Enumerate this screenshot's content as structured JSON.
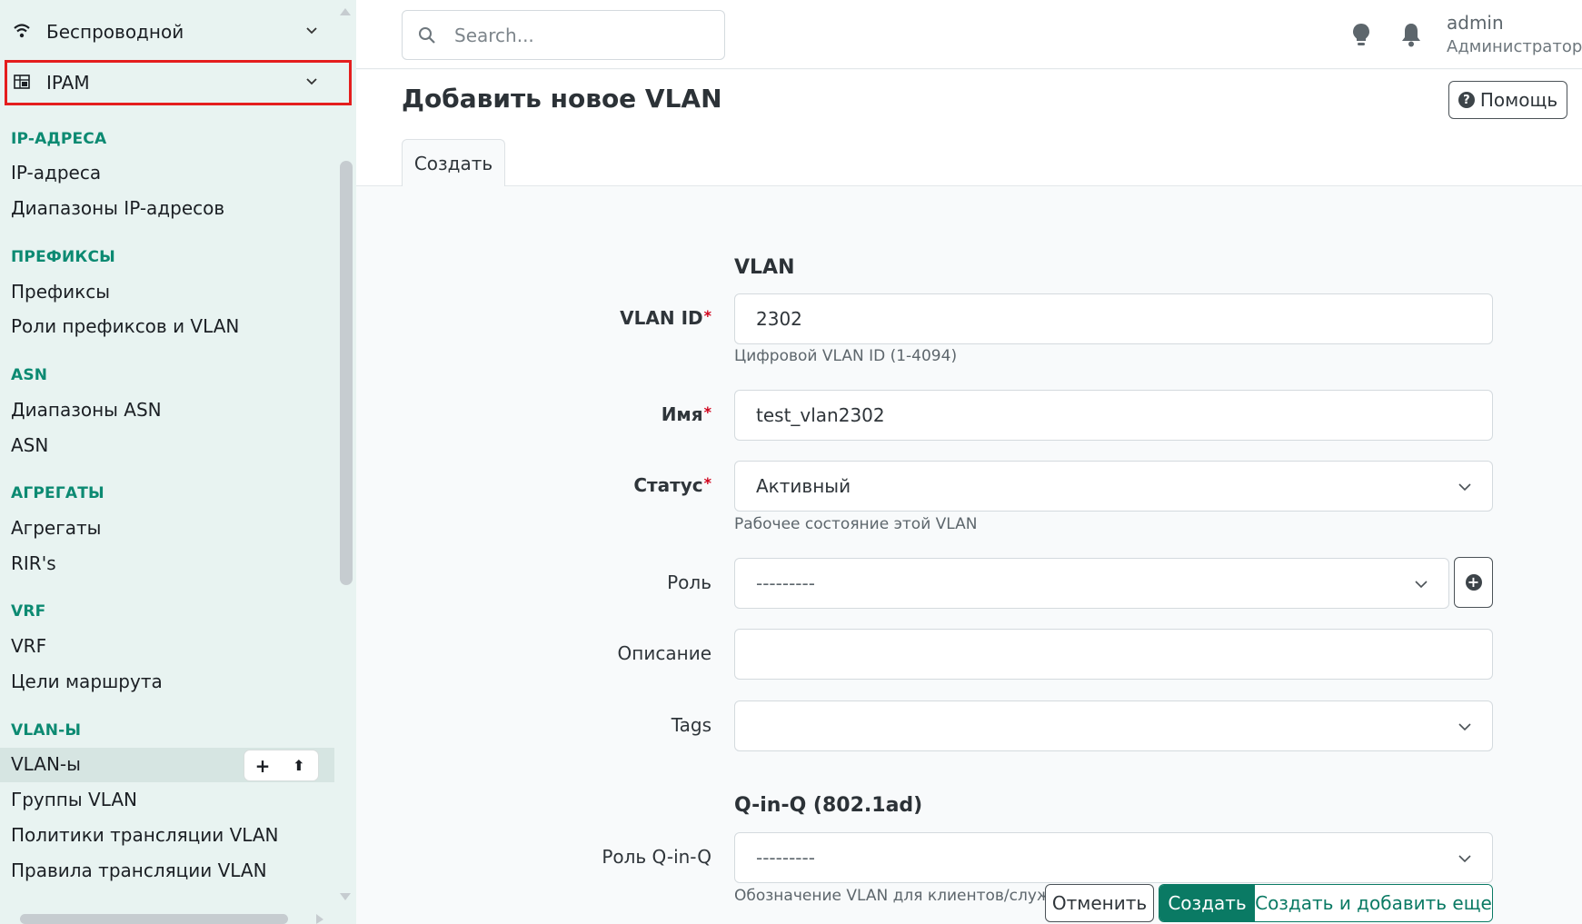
{
  "sidebar": {
    "top_items": [
      {
        "label": "Беспроводной",
        "icon": "wifi-icon"
      },
      {
        "label": "IPAM",
        "icon": "ipam-table-icon"
      }
    ],
    "sections": [
      {
        "header": "IP-АДРЕСА",
        "items": [
          "IP-адреса",
          "Диапазоны IP-адресов"
        ]
      },
      {
        "header": "ПРЕФИКСЫ",
        "items": [
          "Префиксы",
          "Роли префиксов и VLAN"
        ]
      },
      {
        "header": "ASN",
        "items": [
          "Диапазоны ASN",
          "ASN"
        ]
      },
      {
        "header": "АГРЕГАТЫ",
        "items": [
          "Агрегаты",
          "RIR's"
        ]
      },
      {
        "header": "VRF",
        "items": [
          "VRF",
          "Цели маршрута"
        ]
      },
      {
        "header": "VLAN-Ы",
        "items": [
          "VLAN-ы",
          "Группы VLAN",
          "Политики трансляции VLAN",
          "Правила трансляции VLAN"
        ]
      }
    ],
    "quick_actions": {
      "add": "+",
      "import": "⬆"
    }
  },
  "header": {
    "search_placeholder": "Search...",
    "user": {
      "name": "admin",
      "role": "Администратор"
    }
  },
  "page": {
    "title": "Добавить новое VLAN",
    "help_label": "Помощь",
    "tabs": [
      {
        "label": "Создать",
        "active": true
      }
    ]
  },
  "form": {
    "section_vlan": "VLAN",
    "vlan_id": {
      "label": "VLAN ID",
      "value": "2302",
      "help": "Цифровой VLAN ID (1-4094)",
      "required": true
    },
    "name": {
      "label": "Имя",
      "value": "test_vlan2302",
      "required": true
    },
    "status": {
      "label": "Статус",
      "value": "Активный",
      "help": "Рабочее состояние этой VLAN",
      "required": true
    },
    "role": {
      "label": "Роль",
      "value": "---------"
    },
    "description": {
      "label": "Описание",
      "value": ""
    },
    "tags": {
      "label": "Tags",
      "value": ""
    },
    "section_qinq": "Q-in-Q (802.1ad)",
    "qinq_role": {
      "label": "Роль Q-in-Q",
      "value": "---------",
      "help": "Обозначение VLAN для клиентов/служб"
    }
  },
  "actions": {
    "cancel": "Отменить",
    "create": "Создать",
    "create_more": "Создать и добавить еще"
  },
  "colors": {
    "accent": "#0a7a64",
    "sidebar_bg": "#e8f3f1",
    "section_header": "#0c8a72",
    "highlight_box": "#e41e1e",
    "required": "#d0021b"
  }
}
